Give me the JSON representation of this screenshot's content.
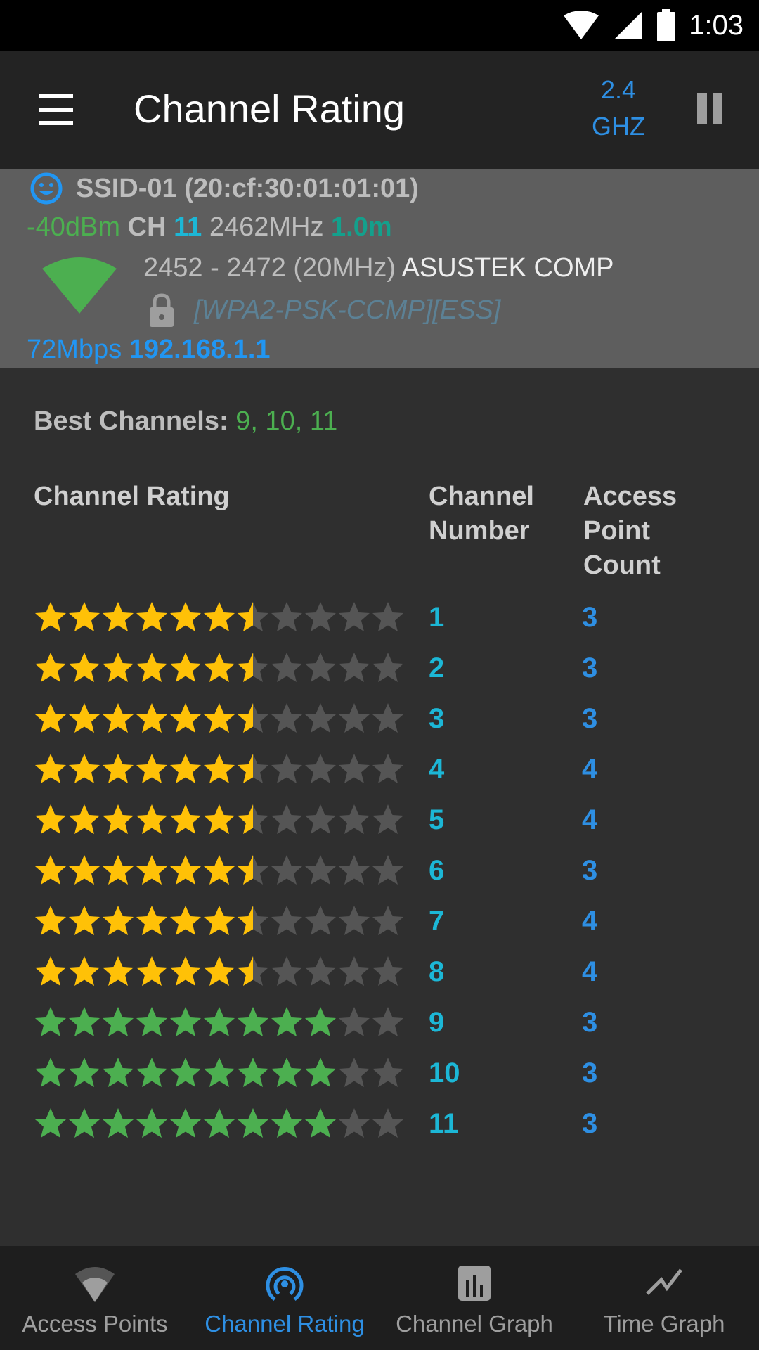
{
  "status_bar": {
    "time": "1:03",
    "icons": [
      "wifi-icon",
      "cell-signal-icon",
      "battery-icon"
    ]
  },
  "app_bar": {
    "menu_icon": "hamburger-menu-icon",
    "title": "Channel Rating",
    "band_line1": "2.4",
    "band_line2": "GHZ",
    "pause_icon": "pause-icon"
  },
  "connected_ap": {
    "status_icon": "smiley-connected-icon",
    "ssid": "SSID-01",
    "bssid": "(20:cf:30:01:01:01)",
    "signal": "-40dBm",
    "ch_label": "CH",
    "channel": "11",
    "frequency": "2462MHz",
    "distance": "1.0m",
    "range": "2452 - 2472",
    "width": "(20MHz)",
    "vendor": "ASUSTEK COMP",
    "security": "[WPA2-PSK-CCMP][ESS]",
    "speed": "72Mbps",
    "ip": "192.168.1.1",
    "colors": {
      "signal": "#4caf50",
      "wifi_strength": "#4caf50"
    }
  },
  "best_channels": {
    "label": "Best Channels:",
    "value": "9, 10, 11"
  },
  "table": {
    "headers": {
      "rating": "Channel Rating",
      "channel_line1": "Channel",
      "channel_line2": "Number",
      "ap_line1": "Access",
      "ap_line2": "Point",
      "ap_line3": "Count"
    },
    "max_stars": 11,
    "rows": [
      {
        "rating": 6.5,
        "channel": "1",
        "ap_count": "3",
        "color": "#ffc107"
      },
      {
        "rating": 6.5,
        "channel": "2",
        "ap_count": "3",
        "color": "#ffc107"
      },
      {
        "rating": 6.5,
        "channel": "3",
        "ap_count": "3",
        "color": "#ffc107"
      },
      {
        "rating": 6.5,
        "channel": "4",
        "ap_count": "4",
        "color": "#ffc107"
      },
      {
        "rating": 6.5,
        "channel": "5",
        "ap_count": "4",
        "color": "#ffc107"
      },
      {
        "rating": 6.5,
        "channel": "6",
        "ap_count": "3",
        "color": "#ffc107"
      },
      {
        "rating": 6.5,
        "channel": "7",
        "ap_count": "4",
        "color": "#ffc107"
      },
      {
        "rating": 6.5,
        "channel": "8",
        "ap_count": "4",
        "color": "#ffc107"
      },
      {
        "rating": 9,
        "channel": "9",
        "ap_count": "3",
        "color": "#4caf50"
      },
      {
        "rating": 9,
        "channel": "10",
        "ap_count": "3",
        "color": "#4caf50"
      },
      {
        "rating": 9,
        "channel": "11",
        "ap_count": "3",
        "color": "#4caf50"
      }
    ]
  },
  "bottom_nav": {
    "items": [
      {
        "label": "Access Points",
        "icon": "wifi-icon",
        "active": false
      },
      {
        "label": "Channel Rating",
        "icon": "broadcast-icon",
        "active": true
      },
      {
        "label": "Channel Graph",
        "icon": "bar-chart-icon",
        "active": false
      },
      {
        "label": "Time Graph",
        "icon": "line-chart-icon",
        "active": false
      }
    ]
  }
}
